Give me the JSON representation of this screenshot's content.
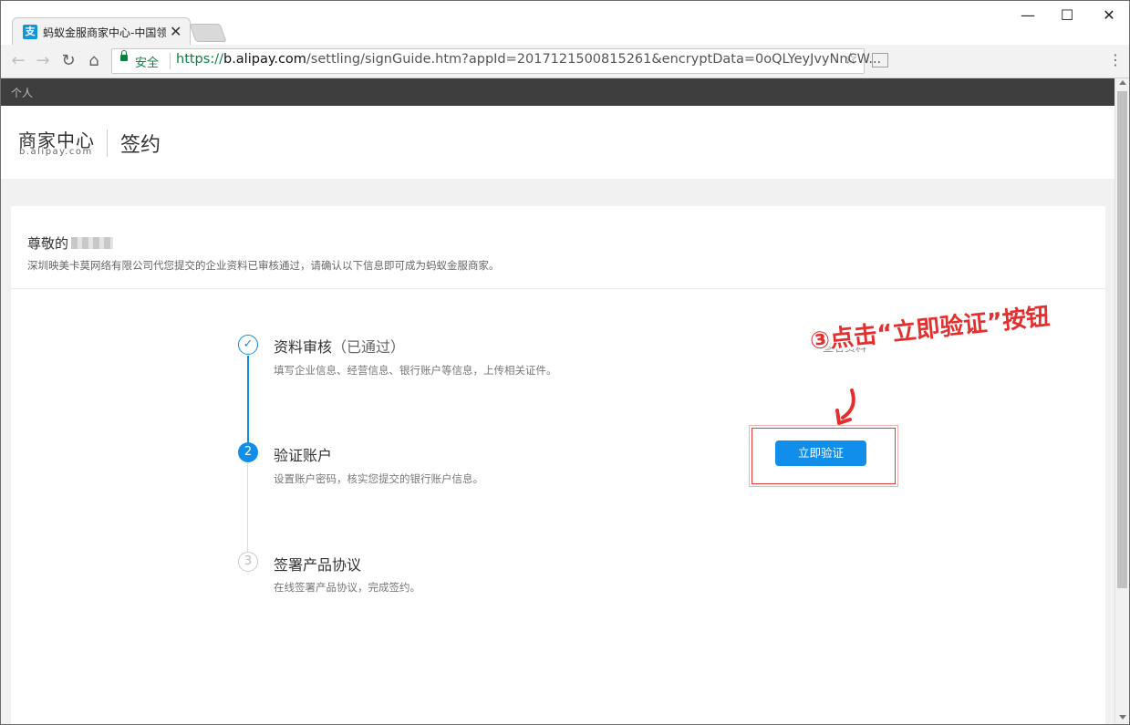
{
  "browser": {
    "tab_title": "蚂蚁金服商家中心-中国领",
    "tab_favicon_glyph": "支",
    "secure_label": "安全",
    "url_scheme": "https://",
    "url_host": "b.alipay.com",
    "url_path": "/settling/signGuide.htm?appId=2017121500815261&encryptData=0oQLYeyJvyNnCW..."
  },
  "topbar": {
    "label": "个人"
  },
  "header": {
    "logo_main": "商家中心",
    "logo_sub": "b.alipay.com",
    "page_title": "签约"
  },
  "greeting": {
    "salutation": "尊敬的",
    "notice": "深圳映美卡莫网络有限公司代您提交的企业资料已审核通过，请确认以下信息即可成为蚂蚁金服商家。"
  },
  "steps": [
    {
      "index": "✓",
      "title": "资料审核",
      "status": "（已通过）",
      "description": "填写企业信息、经营信息、银行账户等信息，上传相关证件。",
      "state": "done",
      "action": "查看资料"
    },
    {
      "index": "2",
      "title": "验证账户",
      "description": "设置账户密码，核实您提交的银行账户信息。",
      "state": "current",
      "action": "立即验证"
    },
    {
      "index": "3",
      "title": "签署产品协议",
      "description": "在线签署产品协议，完成签约。",
      "state": "todo"
    }
  ],
  "annotation": {
    "text": "③点击“立即验证”按钮"
  },
  "colors": {
    "accent": "#108ee9",
    "annotation": "#e52e2e",
    "secure": "#0b8043"
  }
}
